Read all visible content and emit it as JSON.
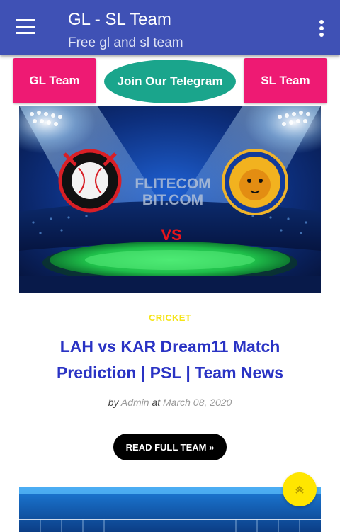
{
  "app": {
    "title": "GL - SL Team",
    "subtitle": "Free gl and sl team",
    "menu_icon": "hamburger-menu-icon",
    "more_icon": "more-vert-icon",
    "bar_color": "#3f51b5"
  },
  "buttons": {
    "gl_label": "GL Team",
    "telegram_label": "Join Our Telegram",
    "sl_label": "SL Team",
    "pink_color": "#ee1a73",
    "telegram_color": "#1aa58c"
  },
  "post": {
    "thumbnail": {
      "watermark_line1": "FLITECOM",
      "watermark_line2": "BIT.COM",
      "vs_text": "VS"
    },
    "category": "CRICKET",
    "title": "LAH vs KAR Dream11 Match Prediction | PSL | Team News",
    "meta_by": "by",
    "author": "Admin",
    "meta_at": "at",
    "date": "March 08, 2020",
    "read_more": "READ FULL TEAM »"
  },
  "fab": {
    "icon": "scroll-to-top-icon",
    "label": "«",
    "color": "#ffe600"
  }
}
